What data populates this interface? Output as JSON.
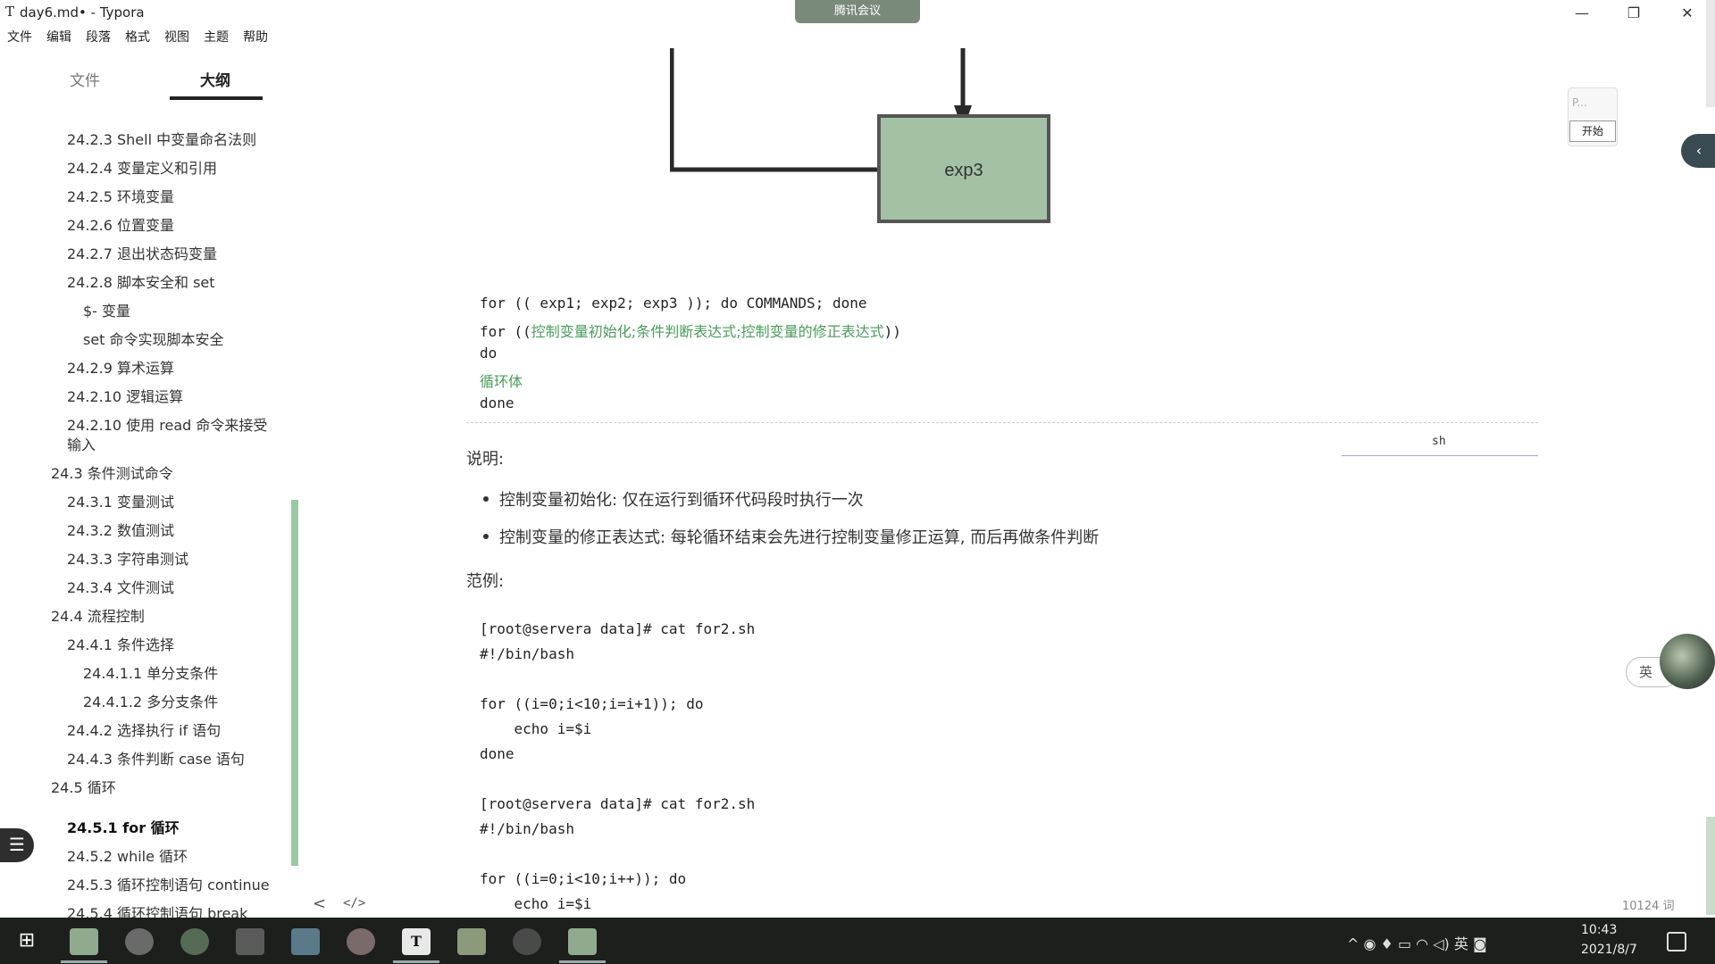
{
  "window": {
    "title": "day6.md• - Typora",
    "app_icon": "T",
    "minimize": "—",
    "maximize": "❐",
    "close": "✕"
  },
  "meeting_badge": "腾讯会议",
  "menu": [
    "文件",
    "编辑",
    "段落",
    "格式",
    "视图",
    "主题",
    "帮助"
  ],
  "sidebar": {
    "tabs": {
      "files": "文件",
      "outline": "大纲"
    },
    "items": [
      {
        "label": "24.2.3 Shell 中变量命名法则",
        "level": 2
      },
      {
        "label": "24.2.4 变量定义和引用",
        "level": 2
      },
      {
        "label": "24.2.5 环境变量",
        "level": 2
      },
      {
        "label": "24.2.6 位置变量",
        "level": 2
      },
      {
        "label": "24.2.7 退出状态码变量",
        "level": 2
      },
      {
        "label": "24.2.8 脚本安全和 set",
        "level": 2
      },
      {
        "label": "$- 变量",
        "level": 3
      },
      {
        "label": "set 命令实现脚本安全",
        "level": 3
      },
      {
        "label": "24.2.9 算术运算",
        "level": 2
      },
      {
        "label": "24.2.10 逻辑运算",
        "level": 2
      },
      {
        "label": "24.2.10 使用 read 命令来接受",
        "level": 2
      },
      {
        "label": "输入",
        "level": 2
      },
      {
        "label": "24.3 条件测试命令",
        "level": 1
      },
      {
        "label": "24.3.1 变量测试",
        "level": 2
      },
      {
        "label": "24.3.2 数值测试",
        "level": 2
      },
      {
        "label": "24.3.3 字符串测试",
        "level": 2
      },
      {
        "label": "24.3.4 文件测试",
        "level": 2
      },
      {
        "label": "24.4 流程控制",
        "level": 1
      },
      {
        "label": "24.4.1 条件选择",
        "level": 2
      },
      {
        "label": "24.4.1.1 单分支条件",
        "level": 3
      },
      {
        "label": "24.4.1.2 多分支条件",
        "level": 3
      },
      {
        "label": "24.4.2 选择执行 if 语句",
        "level": 2
      },
      {
        "label": "24.4.3 条件判断 case 语句",
        "level": 2
      },
      {
        "label": "24.5 循环",
        "level": 1
      },
      {
        "label": "24.5.1 for 循环",
        "level": 2,
        "active": true
      },
      {
        "label": "24.5.2 while 循环",
        "level": 2
      },
      {
        "label": "24.5.3 循环控制语句 continue",
        "level": 2
      },
      {
        "label": "24.5.4 循环控制语句 break",
        "level": 2
      }
    ]
  },
  "diagram": {
    "box_label": "exp3",
    "box_color": "#a3c2a5"
  },
  "code_block_1": {
    "line1": "for (( exp1; exp2; exp3 )); do COMMANDS; done",
    "line2_prefix": "for ((",
    "line2_green": "控制变量初始化;条件判断表达式;控制变量的修正表达式",
    "line2_suffix": "))",
    "line3": "do",
    "line4": "循环体",
    "line5": "done",
    "lang": "sh"
  },
  "explain": {
    "heading": "说明:",
    "bullets": [
      "控制变量初始化: 仅在运行到循环代码段时执行一次",
      "控制变量的修正表达式: 每轮循环结束会先进行控制变量修正运算, 而后再做条件判断"
    ]
  },
  "example": {
    "heading": "范例:",
    "block1": [
      "[root@servera data]# cat for2.sh",
      "#!/bin/bash",
      "",
      "for ((i=0;i<10;i=i+1)); do",
      "    echo i=$i",
      "done"
    ],
    "block2": [
      "[root@servera data]# cat for2.sh",
      "#!/bin/bash",
      "",
      "for ((i=0;i<10;i++)); do",
      "    echo i=$i"
    ]
  },
  "bottom": {
    "back": "<",
    "source": "</>",
    "word_count": "10124 词"
  },
  "floating": {
    "p_label": "P...",
    "start_button": "开始",
    "collapse": "‹",
    "ime": "英"
  },
  "taskbar": {
    "start": "⊞",
    "tray": "^  ◉  ♦  ▭  ◠  ◁)  英  ◙",
    "time": "10:43",
    "date": "2021/8/7"
  }
}
